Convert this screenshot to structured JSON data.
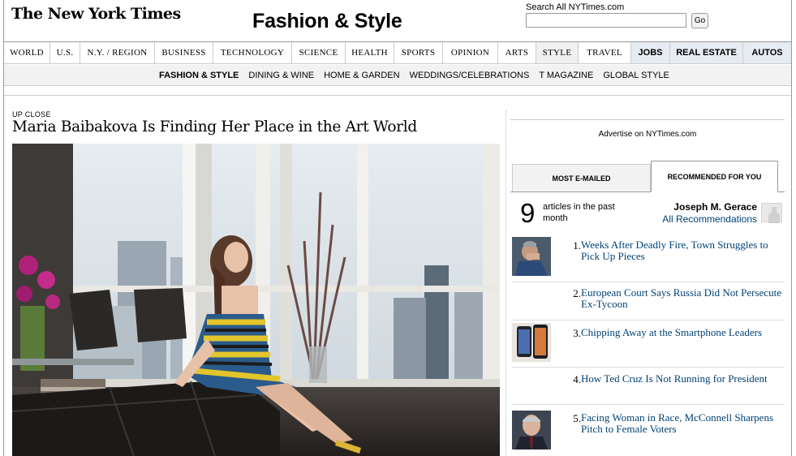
{
  "masthead": {
    "logo": "The New York Times",
    "section_title": "Fashion & Style",
    "search_label": "Search All NYTimes.com",
    "search_value": "",
    "search_button": "Go"
  },
  "main_nav": [
    {
      "label": "WORLD"
    },
    {
      "label": "U.S."
    },
    {
      "label": "N.Y. / REGION"
    },
    {
      "label": "BUSINESS"
    },
    {
      "label": "TECHNOLOGY"
    },
    {
      "label": "SCIENCE"
    },
    {
      "label": "HEALTH"
    },
    {
      "label": "SPORTS"
    },
    {
      "label": "OPINION"
    },
    {
      "label": "ARTS"
    },
    {
      "label": "STYLE"
    },
    {
      "label": "TRAVEL"
    },
    {
      "label": "JOBS"
    },
    {
      "label": "REAL ESTATE"
    },
    {
      "label": "AUTOS"
    }
  ],
  "sub_nav": [
    {
      "label": "FASHION & STYLE"
    },
    {
      "label": "DINING & WINE"
    },
    {
      "label": "HOME & GARDEN"
    },
    {
      "label": "WEDDINGS/CELEBRATIONS"
    },
    {
      "label": "T MAGAZINE"
    },
    {
      "label": "GLOBAL STYLE"
    }
  ],
  "article": {
    "kicker": "UP CLOSE",
    "headline": "Maria Baibakova Is Finding Her Place in the Art World"
  },
  "sidebar": {
    "ad_label": "Advertise on NYTimes.com",
    "tabs": {
      "most_emailed": "MOST E-MAILED",
      "recommended": "RECOMMENDED FOR YOU"
    },
    "count": "9",
    "count_text": "articles in the past month",
    "user_name": "Joseph M. Gerace",
    "all_recommendations": "All Recommendations",
    "stories": [
      {
        "num": "1.",
        "title": "Weeks After Deadly Fire, Town Struggles to Pick Up Pieces"
      },
      {
        "num": "2.",
        "title": "European Court Says Russia Did Not Persecute Ex-Tycoon"
      },
      {
        "num": "3.",
        "title": "Chipping Away at the Smartphone Leaders"
      },
      {
        "num": "4.",
        "title": "How Ted Cruz Is Not Running for President"
      },
      {
        "num": "5.",
        "title": "Facing Woman in Race, McConnell Sharpens Pitch to Female Voters"
      }
    ]
  },
  "colors": {
    "link": "#004276",
    "classified_bg": "#e7ecf2",
    "subnav_bg": "#f2f2f2"
  }
}
